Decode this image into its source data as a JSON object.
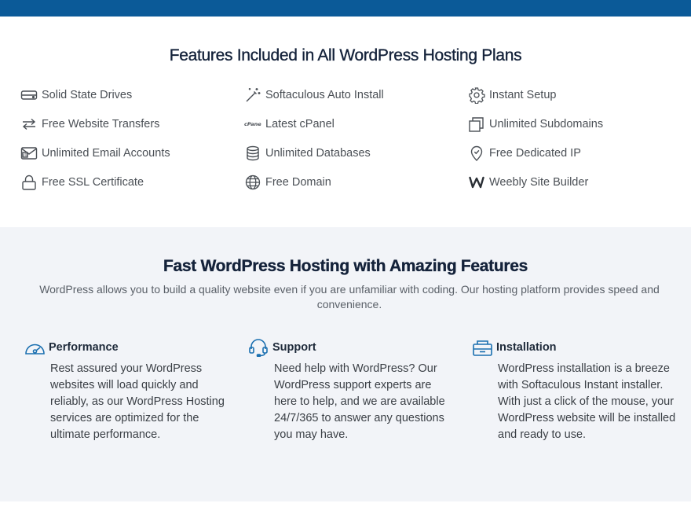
{
  "features_section": {
    "title": "Features Included in All WordPress Hosting Plans",
    "items": [
      {
        "label": "Solid State Drives",
        "icon": "ssd-drive-icon"
      },
      {
        "label": "Softaculous Auto Install",
        "icon": "magic-wand-icon"
      },
      {
        "label": "Instant Setup",
        "icon": "gear-icon"
      },
      {
        "label": "Free Website Transfers",
        "icon": "transfer-arrows-icon"
      },
      {
        "label": "Latest cPanel",
        "icon": "cpanel-logo-icon"
      },
      {
        "label": "Unlimited Subdomains",
        "icon": "stacked-windows-icon"
      },
      {
        "label": "Unlimited Email Accounts",
        "icon": "email-icon"
      },
      {
        "label": "Unlimited Databases",
        "icon": "database-icon"
      },
      {
        "label": "Free Dedicated IP",
        "icon": "location-pin-icon"
      },
      {
        "label": "Free SSL Certificate",
        "icon": "lock-icon"
      },
      {
        "label": "Free Domain",
        "icon": "globe-icon"
      },
      {
        "label": "Weebly Site Builder",
        "icon": "weebly-logo-icon"
      }
    ],
    "cpanel_logo_text": "cPanel"
  },
  "why_section": {
    "title": "Fast WordPress Hosting with Amazing Features",
    "subtitle": "WordPress allows you to build a quality website even if you are unfamiliar with coding. Our hosting platform provides speed and convenience.",
    "columns": [
      {
        "title": "Performance",
        "icon": "speedometer-icon",
        "body": "Rest assured your WordPress websites will load quickly and reliably, as our WordPress Hosting services are optimized for the ultimate performance."
      },
      {
        "title": "Support",
        "icon": "headset-icon",
        "body": "Need help with WordPress? Our WordPress support experts are here to help, and we are available 24/7/365 to answer any questions you may have."
      },
      {
        "title": "Installation",
        "icon": "installer-box-icon",
        "body": "WordPress installation is a breeze with Softaculous Instant installer. With just a click of the mouse, your WordPress website will be installed and ready to use."
      }
    ]
  },
  "colors": {
    "topbar": "#0b5a98",
    "heading": "#14223a",
    "icon_stroke": "#4a4f55",
    "accent_icon": "#1a6fb0",
    "section_bg": "#f2f4f8"
  }
}
